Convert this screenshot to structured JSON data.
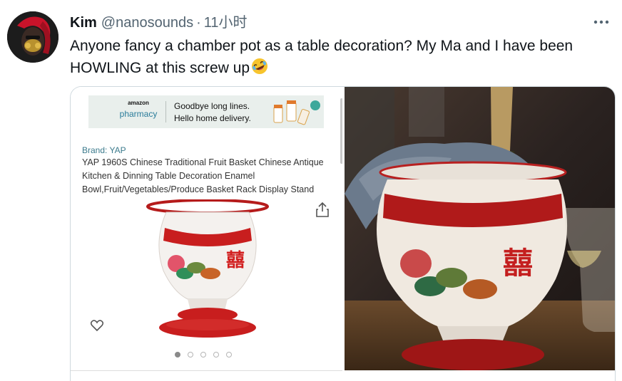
{
  "tweet": {
    "author_name": "Kim",
    "handle": "@nanosounds",
    "separator": "·",
    "timestamp": "11小时",
    "text": "Anyone fancy a chamber pot as a table decoration? My Ma and I have been HOWLING at this screw up",
    "emoji": "rolling-on-floor-laughing"
  },
  "more_icon": "more-icon",
  "listing": {
    "banner": {
      "logo_line1": "amazon",
      "logo_line2": "pharmacy",
      "line1": "Goodbye long lines.",
      "line2": "Hello home delivery."
    },
    "brand": "Brand: YAP",
    "title": "YAP 1960S Chinese Traditional Fruit Basket Chinese Antique Kitchen & Dinning Table Decoration Enamel Bowl,Fruit/Vegetables/Produce Basket Rack Display Stand",
    "pager": {
      "count": 5,
      "active": 1
    },
    "icons": [
      "share-icon",
      "heart-icon"
    ]
  },
  "colors": {
    "text": "#0f1419",
    "secondary": "#536471",
    "border": "#cfd9de",
    "brand_teal": "#3b7a8c",
    "enamel_red": "#c81e1e"
  }
}
